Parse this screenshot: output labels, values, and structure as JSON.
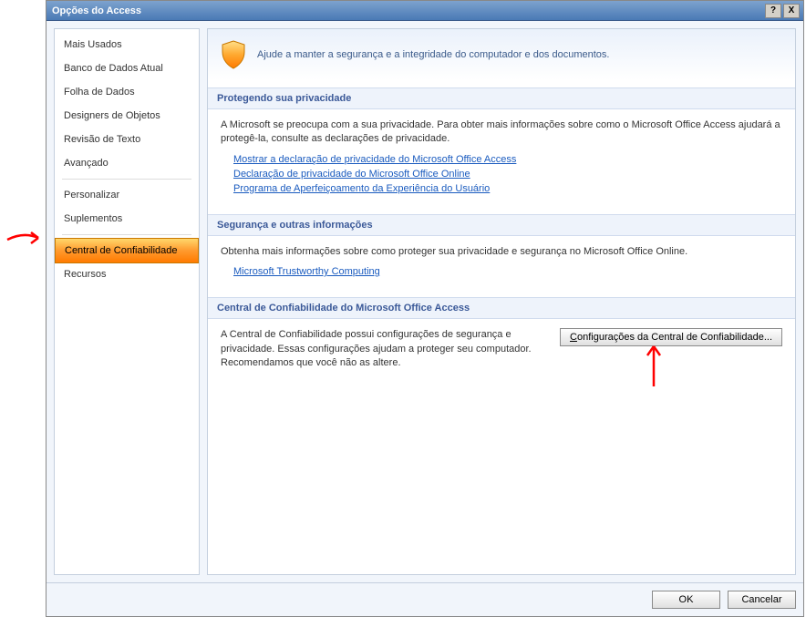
{
  "titlebar": {
    "title": "Opções do Access",
    "help_glyph": "?",
    "close_glyph": "X"
  },
  "sidebar": {
    "items": [
      {
        "label": "Mais Usados"
      },
      {
        "label": "Banco de Dados Atual"
      },
      {
        "label": "Folha de Dados"
      },
      {
        "label": "Designers de Objetos"
      },
      {
        "label": "Revisão de Texto"
      },
      {
        "label": "Avançado"
      },
      {
        "label": "Personalizar"
      },
      {
        "label": "Suplementos"
      },
      {
        "label": "Central de Confiabilidade"
      },
      {
        "label": "Recursos"
      }
    ]
  },
  "hero": {
    "text": "Ajude a manter a segurança e a integridade do computador e dos documentos."
  },
  "sections": {
    "privacy": {
      "header": "Protegendo sua privacidade",
      "body": "A Microsoft se preocupa com a sua privacidade. Para obter mais informações sobre como o Microsoft Office Access ajudará a protegê-la, consulte as declarações de privacidade.",
      "links": [
        "Mostrar a declaração de privacidade do Microsoft Office Access",
        "Declaração de privacidade do Microsoft Office Online",
        "Programa de Aperfeiçoamento da Experiência do Usuário"
      ]
    },
    "security": {
      "header": "Segurança e outras informações",
      "body": "Obtenha mais informações sobre como proteger sua privacidade e segurança no Microsoft Office Online.",
      "links": [
        "Microsoft Trustworthy Computing"
      ]
    },
    "trust": {
      "header": "Central de Confiabilidade do Microsoft Office Access",
      "body": "A Central de Confiabilidade possui configurações de segurança e privacidade. Essas configurações ajudam a proteger seu computador. Recomendamos que você não as altere.",
      "button": "Configurações da Central de Confiabilidade..."
    }
  },
  "footer": {
    "ok": "OK",
    "cancel": "Cancelar"
  }
}
